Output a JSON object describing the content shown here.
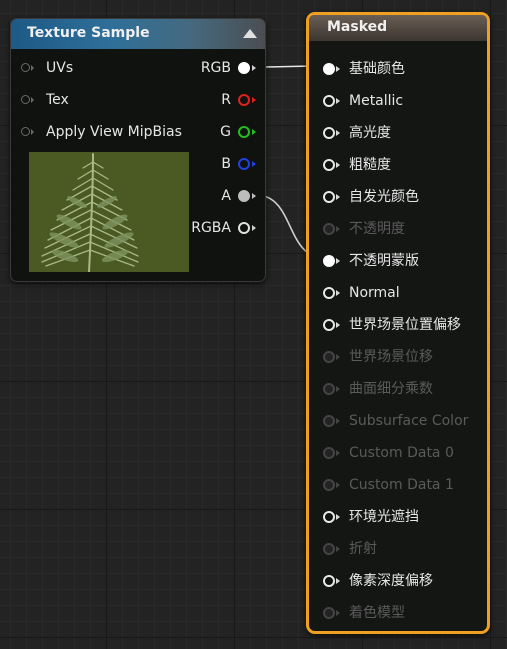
{
  "texture_node": {
    "title": "Texture Sample",
    "inputs": [
      "UVs",
      "Tex",
      "Apply View MipBias"
    ],
    "outputs": [
      {
        "label": "RGB",
        "color": "#ffffff",
        "filled": true
      },
      {
        "label": "R",
        "color": "#e02020",
        "filled": false
      },
      {
        "label": "G",
        "color": "#20c020",
        "filled": false
      },
      {
        "label": "B",
        "color": "#2040e0",
        "filled": false
      },
      {
        "label": "A",
        "color": "#bcbcbc",
        "filled": true
      },
      {
        "label": "RGBA",
        "color": "#e0e0e0",
        "filled": false
      }
    ],
    "preview_icon": "fern-leaf-icon"
  },
  "masked_node": {
    "title": "Masked",
    "border_color": "#f0a020",
    "pins": [
      {
        "label": "基础颜色",
        "state": "connected"
      },
      {
        "label": "Metallic",
        "state": "active"
      },
      {
        "label": "高光度",
        "state": "active"
      },
      {
        "label": "粗糙度",
        "state": "active"
      },
      {
        "label": "自发光颜色",
        "state": "active"
      },
      {
        "label": "不透明度",
        "state": "disabled"
      },
      {
        "label": "不透明蒙版",
        "state": "connected"
      },
      {
        "label": "Normal",
        "state": "active"
      },
      {
        "label": "世界场景位置偏移",
        "state": "active"
      },
      {
        "label": "世界场景位移",
        "state": "disabled"
      },
      {
        "label": "曲面细分乘数",
        "state": "disabled"
      },
      {
        "label": "Subsurface Color",
        "state": "disabled"
      },
      {
        "label": "Custom Data 0",
        "state": "disabled"
      },
      {
        "label": "Custom Data 1",
        "state": "disabled"
      },
      {
        "label": "环境光遮挡",
        "state": "active"
      },
      {
        "label": "折射",
        "state": "disabled"
      },
      {
        "label": "像素深度偏移",
        "state": "active"
      },
      {
        "label": "着色模型",
        "state": "disabled"
      }
    ]
  }
}
